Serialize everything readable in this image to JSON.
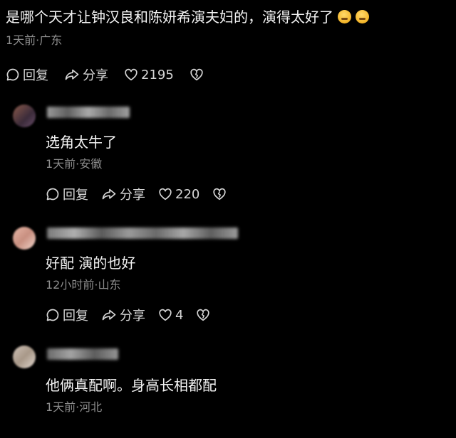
{
  "main_comment": {
    "text": "是哪个天才让钟汉良和陈妍希演夫妇的，演得太好了",
    "emojis": [
      "crying-face",
      "crying-face"
    ],
    "meta": "1天前·广东",
    "actions": {
      "reply": "回复",
      "share": "分享",
      "likes": "2195"
    }
  },
  "replies": [
    {
      "text": "选角太牛了",
      "meta": "1天前·安徽",
      "reply": "回复",
      "share": "分享",
      "likes": "220"
    },
    {
      "text": "好配 演的也好",
      "meta": "12小时前·山东",
      "reply": "回复",
      "share": "分享",
      "likes": "4"
    },
    {
      "text": "他俩真配啊。身高长相都配",
      "meta": "1天前·河北"
    }
  ],
  "colors": {
    "background": "#000000",
    "text": "#f4f4f4",
    "meta": "#8d8d8d",
    "action": "#d6d6d6"
  }
}
